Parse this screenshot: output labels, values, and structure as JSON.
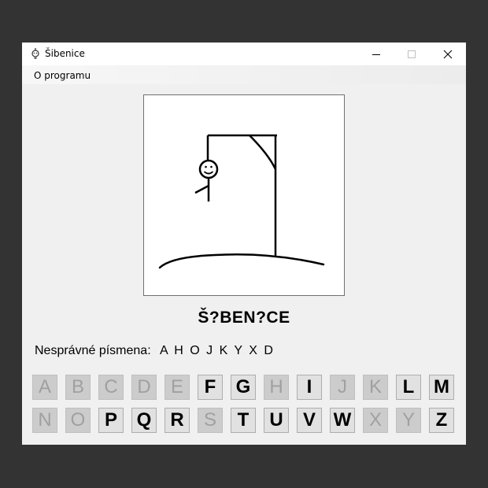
{
  "window": {
    "title": "Šibenice",
    "minimize_glyph": "—",
    "maximize_glyph": "☐",
    "close_glyph": "✕"
  },
  "menu": {
    "items": [
      "O programu"
    ]
  },
  "game": {
    "word": "Š?BEN?CE",
    "wrong_label": "Nesprávné písmena:",
    "wrong_letters": "A H O J K Y X D"
  },
  "keyboard": {
    "keys": [
      {
        "letter": "A",
        "state": "used"
      },
      {
        "letter": "B",
        "state": "used"
      },
      {
        "letter": "C",
        "state": "used"
      },
      {
        "letter": "D",
        "state": "used"
      },
      {
        "letter": "E",
        "state": "used"
      },
      {
        "letter": "F",
        "state": "enabled"
      },
      {
        "letter": "G",
        "state": "enabled"
      },
      {
        "letter": "H",
        "state": "used"
      },
      {
        "letter": "I",
        "state": "enabled"
      },
      {
        "letter": "J",
        "state": "used"
      },
      {
        "letter": "K",
        "state": "used"
      },
      {
        "letter": "L",
        "state": "enabled"
      },
      {
        "letter": "M",
        "state": "enabled"
      },
      {
        "letter": "N",
        "state": "used"
      },
      {
        "letter": "O",
        "state": "used"
      },
      {
        "letter": "P",
        "state": "enabled"
      },
      {
        "letter": "Q",
        "state": "enabled"
      },
      {
        "letter": "R",
        "state": "enabled"
      },
      {
        "letter": "S",
        "state": "used"
      },
      {
        "letter": "T",
        "state": "enabled"
      },
      {
        "letter": "U",
        "state": "enabled"
      },
      {
        "letter": "V",
        "state": "enabled"
      },
      {
        "letter": "W",
        "state": "enabled"
      },
      {
        "letter": "X",
        "state": "used"
      },
      {
        "letter": "Y",
        "state": "used"
      },
      {
        "letter": "Z",
        "state": "enabled"
      }
    ]
  },
  "colors": {
    "desktop": "#333333",
    "window_bg": "#f0f0f0",
    "key_enabled_bg": "#e1e1e1",
    "key_used_bg": "#cccccc",
    "key_used_text": "#a0a0a0"
  }
}
